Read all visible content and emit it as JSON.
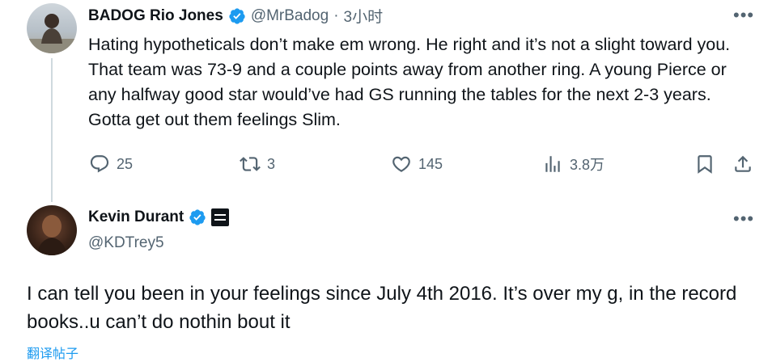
{
  "tweet1": {
    "author_name": "BADOG Rio Jones",
    "handle": "@MrBadog",
    "time": "3小时",
    "body": "Hating hypotheticals don’t make em wrong. He right and it’s not a slight toward you. That team was 73-9 and a couple points away from another ring. A young Pierce or any halfway good star would’ve had GS running the tables for the next 2-3 years. Gotta get out them feelings Slim.",
    "actions": {
      "replies": "25",
      "retweets": "3",
      "likes": "145",
      "views": "3.8万"
    }
  },
  "tweet2": {
    "author_name": "Kevin Durant",
    "handle": "@KDTrey5",
    "body": "I can tell you been in your feelings since July 4th 2016. It’s over my g, in the record books..u can’t do nothin bout it",
    "translate": "翻译帖子"
  },
  "colors": {
    "verified": "#1d9bf0",
    "secondary_text": "#536471",
    "thread_line": "#cfd9de"
  },
  "icons": [
    "more-icon",
    "verified-icon",
    "reply-icon",
    "retweet-icon",
    "like-icon",
    "views-icon",
    "bookmark-icon",
    "share-icon",
    "affiliate-badge-icon"
  ]
}
